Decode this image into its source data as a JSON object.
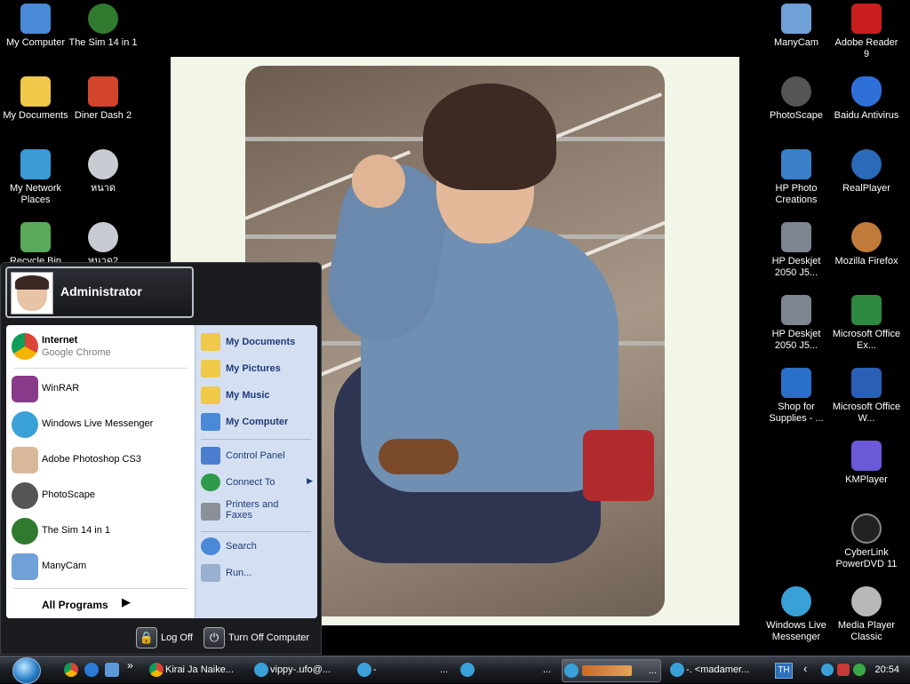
{
  "desktop": {
    "left_icons": [
      {
        "label": "My Computer",
        "icon": "computer-icon",
        "color": "#4a88d8"
      },
      {
        "label": "The Sim 14 in 1",
        "icon": "sims-icon",
        "color": "#2f7a2f"
      },
      {
        "label": "My Documents",
        "icon": "folder-icon",
        "color": "#f0c94a"
      },
      {
        "label": "Diner Dash 2",
        "icon": "diner-dash-icon",
        "color": "#d2452c"
      },
      {
        "label": "My Network Places",
        "icon": "network-icon",
        "color": "#3c9ad6"
      },
      {
        "label": "หนาด",
        "icon": "disc-icon",
        "color": "#c8ccd2"
      },
      {
        "label": "Recycle Bin",
        "icon": "recycle-bin-icon",
        "color": "#5aa85a"
      },
      {
        "label": "หนาด2",
        "icon": "disc-icon",
        "color": "#c8ccd2"
      }
    ],
    "right_icons": [
      {
        "label": "ManyCam",
        "icon": "manycam-icon",
        "color": "#6fa0d8"
      },
      {
        "label": "Adobe Reader 9",
        "icon": "pdf-icon",
        "color": "#c81e1e"
      },
      {
        "label": "PhotoScape",
        "icon": "photoscape-icon",
        "color": "#555555"
      },
      {
        "label": "Baidu Antivirus",
        "icon": "shield-icon",
        "color": "#2f6fd8"
      },
      {
        "label": "HP Photo Creations",
        "icon": "photo-creations-icon",
        "color": "#3a80c8"
      },
      {
        "label": "RealPlayer",
        "icon": "realplayer-icon",
        "color": "#2a6ab8"
      },
      {
        "label": "HP Deskjet 2050 J5...",
        "icon": "scanner-icon",
        "color": "#7d8591"
      },
      {
        "label": "Mozilla Firefox",
        "icon": "firefox-icon",
        "color": "#c07a3a"
      },
      {
        "label": "HP Deskjet 2050 J5...",
        "icon": "printer-icon",
        "color": "#7d8591"
      },
      {
        "label": "Microsoft Office Ex...",
        "icon": "excel-icon",
        "color": "#2e8a3e"
      },
      {
        "label": "Shop for Supplies - ...",
        "icon": "shop-icon",
        "color": "#2a6fc8"
      },
      {
        "label": "Microsoft Office W...",
        "icon": "word-icon",
        "color": "#2a5fb8"
      },
      {
        "label": "KMPlayer",
        "icon": "kmplayer-icon",
        "color": "#6a5ad8"
      },
      {
        "label": "CyberLink PowerDVD 11",
        "icon": "powerdvd-icon",
        "color": "#222222"
      },
      {
        "label": "Windows Live Messenger",
        "icon": "messenger-icon",
        "color": "#3aa0d8"
      },
      {
        "label": "Media Player Classic",
        "icon": "media-player-icon",
        "color": "#b8b8b8"
      }
    ]
  },
  "start_menu": {
    "user_name": "Administrator",
    "pinned": [
      {
        "title": "Internet",
        "subtitle": "Google Chrome",
        "icon": "chrome-icon",
        "color": "#db4437"
      }
    ],
    "recent": [
      {
        "label": "WinRAR",
        "icon": "winrar-icon",
        "color": "#8a3a8a"
      },
      {
        "label": "Windows Live Messenger",
        "icon": "messenger-icon",
        "color": "#3aa0d8"
      },
      {
        "label": "Adobe Photoshop CS3",
        "icon": "photoshop-icon",
        "color": "#d8b89a"
      },
      {
        "label": "PhotoScape",
        "icon": "photoscape-icon",
        "color": "#555555"
      },
      {
        "label": "The Sim 14 in 1",
        "icon": "sims-icon",
        "color": "#2f7a2f"
      },
      {
        "label": "ManyCam",
        "icon": "manycam-icon",
        "color": "#6fa0d8"
      }
    ],
    "all_programs": "All Programs",
    "right_group1": [
      {
        "label": "My Documents",
        "icon": "folder-icon",
        "color": "#f0c94a"
      },
      {
        "label": "My Pictures",
        "icon": "pictures-folder-icon",
        "color": "#f0c94a"
      },
      {
        "label": "My Music",
        "icon": "music-folder-icon",
        "color": "#f0c94a"
      },
      {
        "label": "My Computer",
        "icon": "computer-icon",
        "color": "#4a88d8"
      }
    ],
    "right_group2": [
      {
        "label": "Control Panel",
        "icon": "control-panel-icon",
        "color": "#4a7fd0"
      },
      {
        "label": "Connect To",
        "icon": "globe-icon",
        "color": "#2e9a4a"
      },
      {
        "label": "Printers and Faxes",
        "icon": "printer-icon",
        "color": "#8a8f98"
      }
    ],
    "right_group3": [
      {
        "label": "Search",
        "icon": "search-icon",
        "color": "#4a88d8"
      },
      {
        "label": "Run...",
        "icon": "run-icon",
        "color": "#9ab0d0"
      }
    ],
    "log_off": "Log Off",
    "turn_off": "Turn Off Computer"
  },
  "taskbar": {
    "quick_launch": [
      {
        "icon": "chrome-icon",
        "color": "#db4437"
      },
      {
        "icon": "ie-icon",
        "color": "#2a7ad8"
      },
      {
        "icon": "window-icon",
        "color": "#5a9ad8"
      }
    ],
    "more": "»",
    "tasks": [
      {
        "label": "Kirai Ja Naike...",
        "icon": "chrome-icon",
        "color": "#db4437"
      },
      {
        "label": "vippy-.ufo@...",
        "icon": "messenger-icon",
        "color": "#3aa0d8"
      },
      {
        "label": "-",
        "icon": "messenger-icon",
        "color": "#3aa0d8"
      },
      {
        "label": "...",
        "icon": "messenger-icon",
        "color": "#3aa0d8"
      },
      {
        "label": "...",
        "icon": "messenger-icon",
        "color": "#3aa0d8"
      },
      {
        "label": "...",
        "icon": "messenger-icon",
        "color": "#3aa0d8"
      },
      {
        "label": "-. <madamer...",
        "icon": "messenger-icon",
        "color": "#3aa0d8"
      }
    ],
    "language": "TH",
    "clock": "20:54"
  }
}
